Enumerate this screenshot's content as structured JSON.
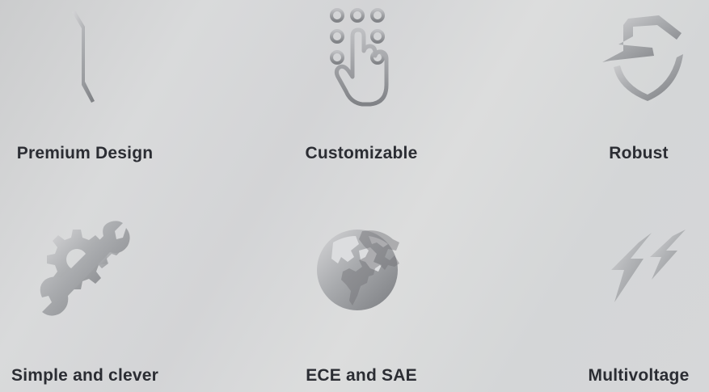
{
  "colors": {
    "background": "#d6d7d9",
    "label_text": "#2b2d33",
    "icon_light": "#d4d4d6",
    "icon_dark": "#7d7f83"
  },
  "features": [
    {
      "label": "Premium Design",
      "icon": "sleek-strip-icon"
    },
    {
      "label": "Customizable",
      "icon": "hand-keypad-icon"
    },
    {
      "label": "Robust",
      "icon": "shield-icon"
    },
    {
      "label": "Simple and clever",
      "icon": "gear-wrench-icon"
    },
    {
      "label": "ECE and SAE",
      "icon": "globe-icon"
    },
    {
      "label": "Multivoltage",
      "icon": "lightning-bolts-icon"
    }
  ]
}
